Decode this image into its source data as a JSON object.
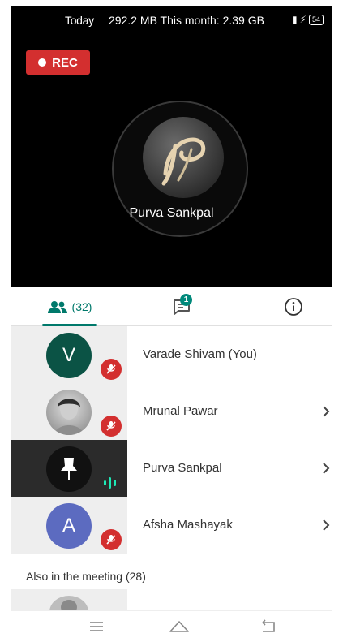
{
  "status_bar": {
    "time": "Today",
    "usage_text": "292.2 MB This month: 2.39 GB",
    "battery": "54"
  },
  "video": {
    "rec_label": "REC",
    "speaker_name": "Purva Sankpal"
  },
  "tabs": {
    "people_count": "(32)",
    "chat_badge": "1"
  },
  "participants": [
    {
      "initial": "V",
      "name": "Varade Shivam (You)",
      "avatar_color": "#0b5345",
      "status": "muted"
    },
    {
      "initial": "",
      "name": "Mrunal Pawar",
      "avatar_color": "#bdbdbd",
      "status": "muted"
    },
    {
      "initial": "",
      "name": "Purva Sankpal",
      "avatar_color": "#1a1a1a",
      "status": "speaking"
    },
    {
      "initial": "A",
      "name": "Afsha Mashayak",
      "avatar_color": "#5c6bc0",
      "status": "muted"
    }
  ],
  "also_in_meeting": "Also in the meeting (28)",
  "colors": {
    "accent": "#00796b",
    "rec_red": "#d32f2f",
    "speaking_green": "#1de9b6"
  }
}
